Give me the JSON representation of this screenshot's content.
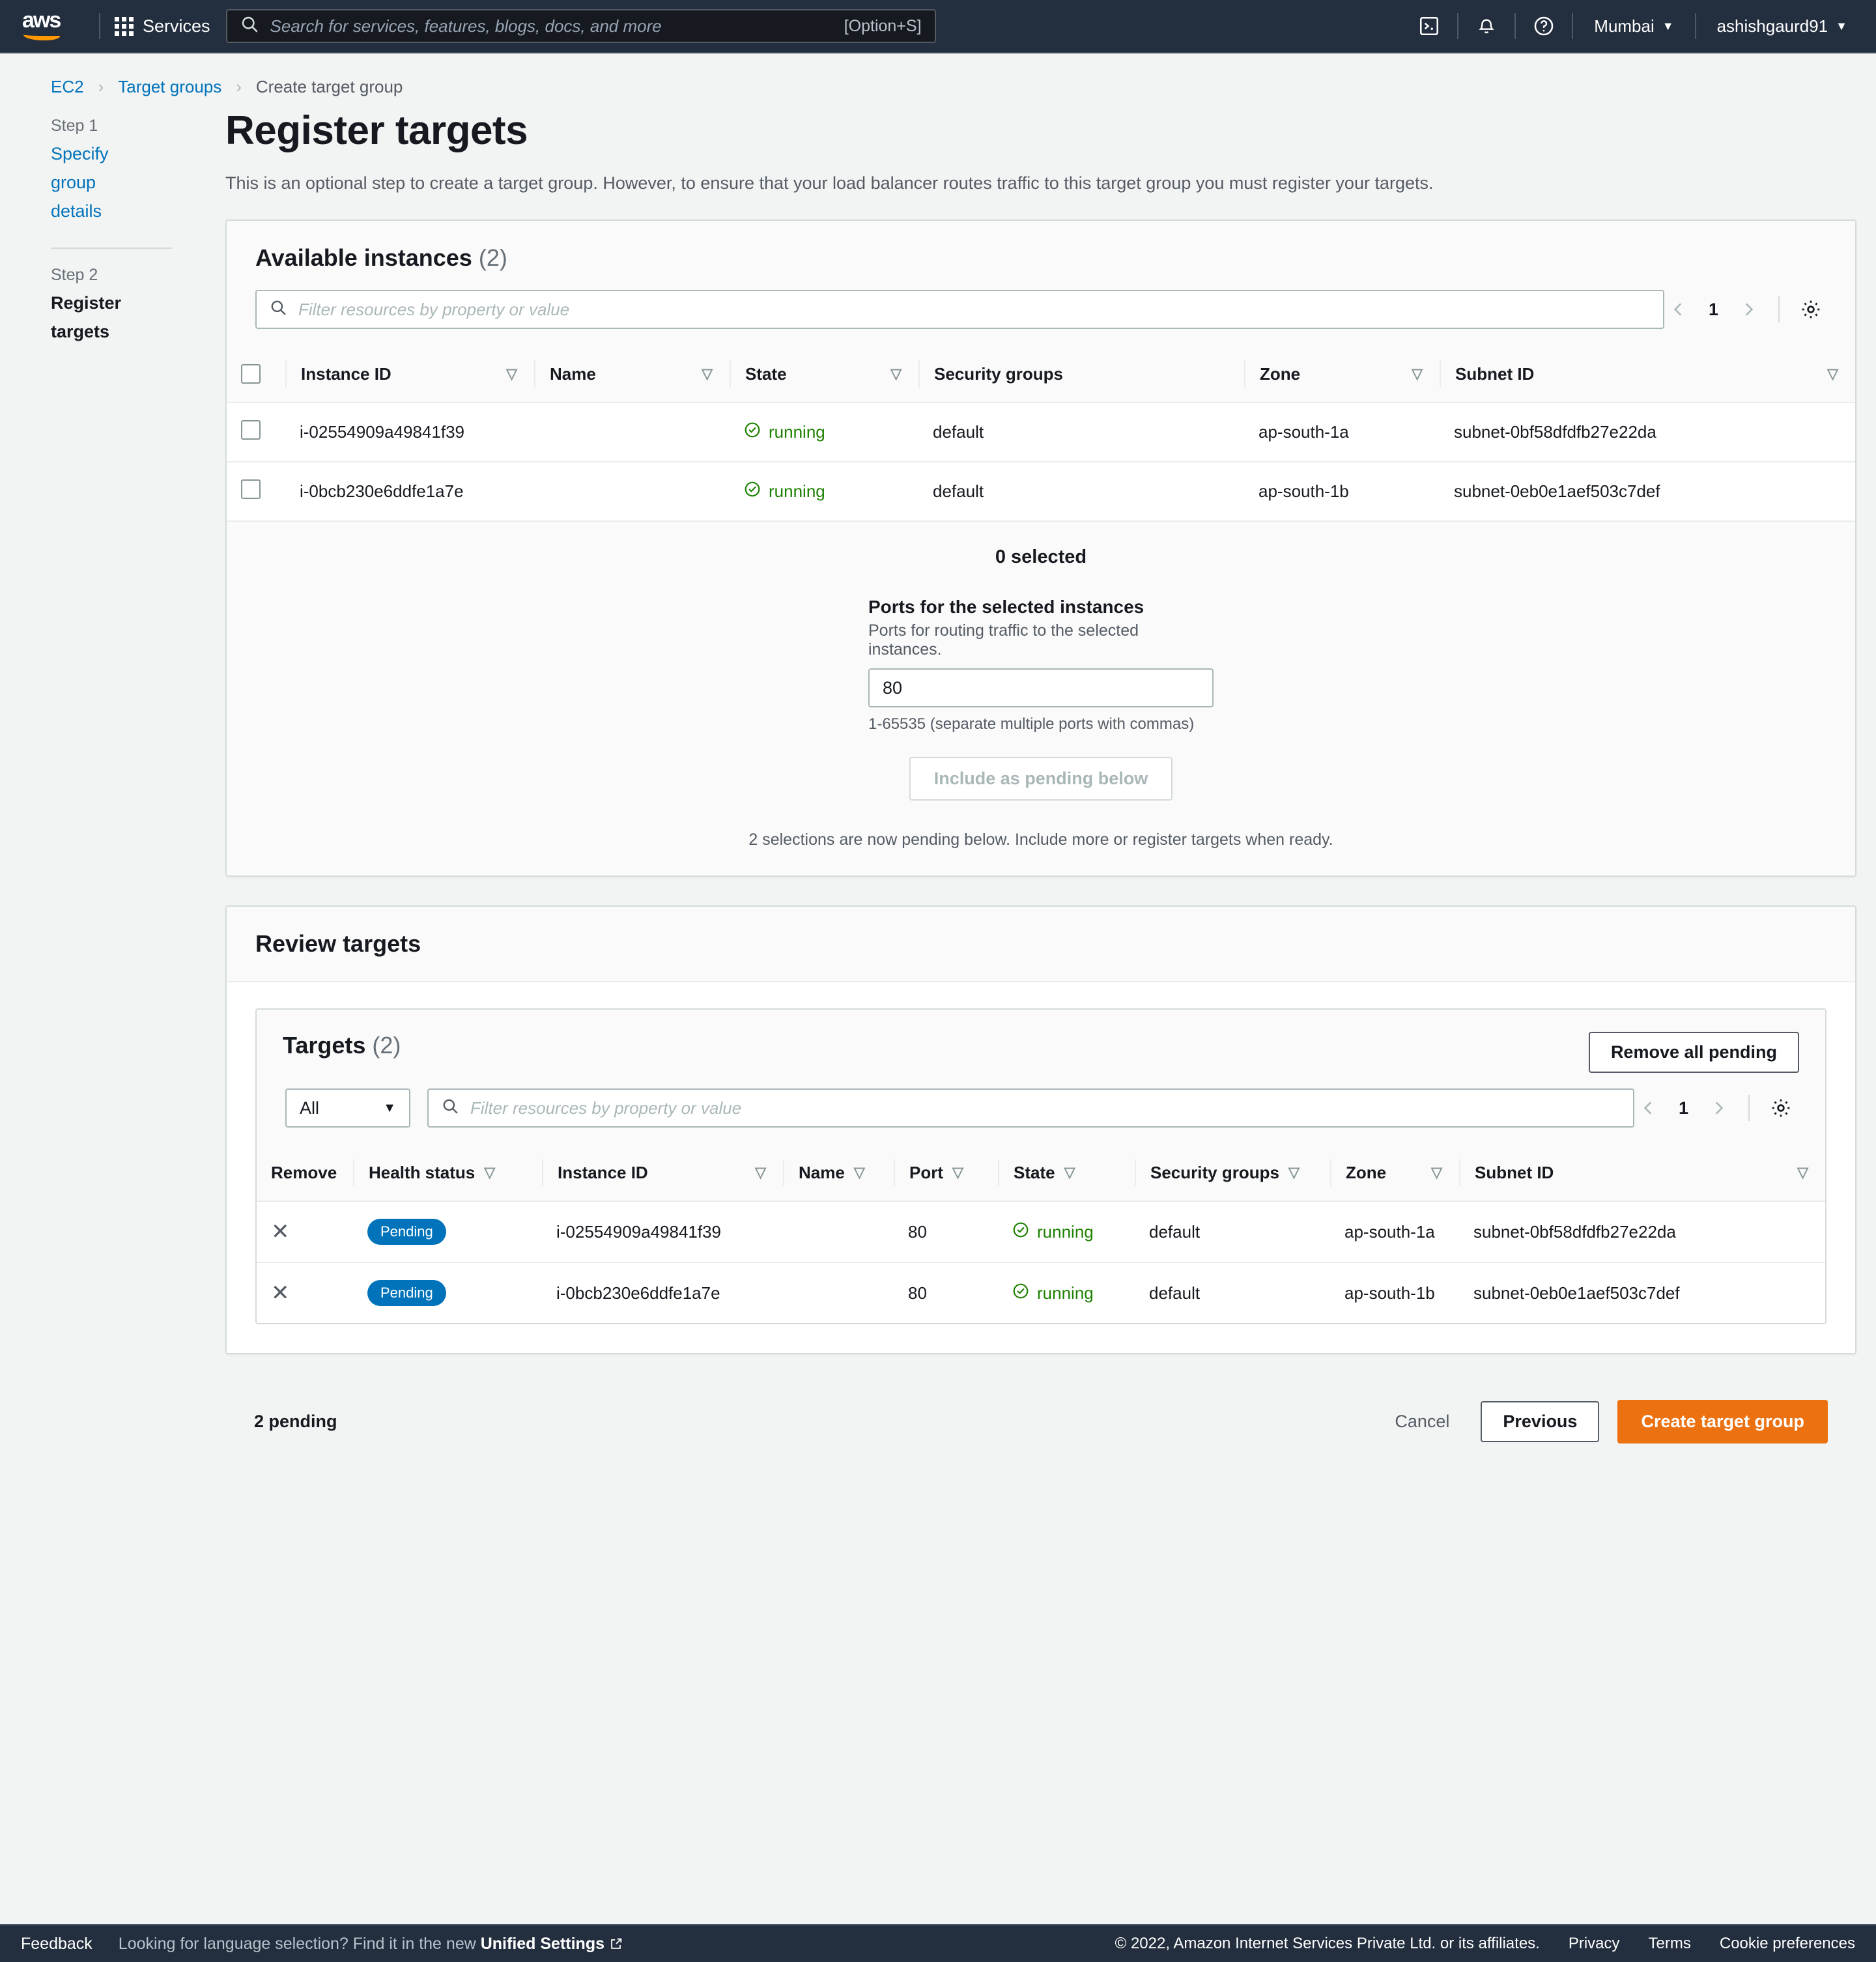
{
  "topnav": {
    "logo_text": "aws",
    "services_label": "Services",
    "search_placeholder": "Search for services, features, blogs, docs, and more",
    "search_value": "",
    "keyboard_hint": "[Option+S]",
    "cloudshell_icon": "cloudshell-icon",
    "bell_icon": "notifications-bell-icon",
    "help_icon": "help-question-icon",
    "region": "Mumbai",
    "account": "ashishgaurd91"
  },
  "breadcrumb": {
    "items": [
      {
        "label": "EC2",
        "link": true
      },
      {
        "label": "Target groups",
        "link": true
      },
      {
        "label": "Create target group",
        "link": false
      }
    ],
    "separator": "›"
  },
  "steps": [
    {
      "num": "Step 1",
      "label_line1": "Specify",
      "label_line2": "group",
      "label_line3": "details",
      "active": false
    },
    {
      "num": "Step 2",
      "label_line1": "Register",
      "label_line2": "targets",
      "label_line3": "",
      "active": true
    }
  ],
  "page": {
    "title": "Register targets",
    "description": "This is an optional step to create a target group. However, to ensure that your load balancer routes traffic to this target group you must register your targets."
  },
  "available_instances": {
    "title": "Available instances",
    "count": "(2)",
    "filter_placeholder": "Filter resources by property or value",
    "filter_value": "",
    "page_number": "1",
    "prev_icon": "chevron-left-icon",
    "next_icon": "chevron-right-icon",
    "settings_icon": "gear-icon",
    "columns": [
      "Instance ID",
      "Name",
      "State",
      "Security groups",
      "Zone",
      "Subnet ID"
    ],
    "sortable": [
      true,
      true,
      true,
      false,
      true,
      true
    ],
    "rows": [
      {
        "instance_id": "i-02554909a49841f39",
        "name": "",
        "state": "running",
        "security_groups": "default",
        "zone": "ap-south-1a",
        "subnet_id": "subnet-0bf58dfdfb27e22da"
      },
      {
        "instance_id": "i-0bcb230e6ddfe1a7e",
        "name": "",
        "state": "running",
        "security_groups": "default",
        "zone": "ap-south-1b",
        "subnet_id": "subnet-0eb0e1aef503c7def"
      }
    ],
    "selection": {
      "selected_text": "0 selected",
      "ports_label": "Ports for the selected instances",
      "ports_description": "Ports for routing traffic to the selected instances.",
      "ports_value": "80",
      "ports_hint": "1-65535 (separate multiple ports with commas)",
      "include_button": "Include as pending below",
      "include_button_disabled": true,
      "pending_note": "2 selections are now pending below. Include more or register targets when ready."
    }
  },
  "review_targets": {
    "title": "Review targets",
    "targets_title": "Targets",
    "targets_count": "(2)",
    "remove_all_button": "Remove all pending",
    "select_value": "All",
    "filter_placeholder": "Filter resources by property or value",
    "filter_value": "",
    "page_number": "1",
    "columns": [
      "Remove",
      "Health status",
      "Instance ID",
      "Name",
      "Port",
      "State",
      "Security groups",
      "Zone",
      "Subnet ID"
    ],
    "rows": [
      {
        "remove_icon": "remove-x-icon",
        "health_status": "Pending",
        "instance_id": "i-02554909a49841f39",
        "name": "",
        "port": "80",
        "state": "running",
        "security_groups": "default",
        "zone": "ap-south-1a",
        "subnet_id": "subnet-0bf58dfdfb27e22da"
      },
      {
        "remove_icon": "remove-x-icon",
        "health_status": "Pending",
        "instance_id": "i-0bcb230e6ddfe1a7e",
        "name": "",
        "port": "80",
        "state": "running",
        "security_groups": "default",
        "zone": "ap-south-1b",
        "subnet_id": "subnet-0eb0e1aef503c7def"
      }
    ]
  },
  "action_bar": {
    "pending_count": "2 pending",
    "cancel": "Cancel",
    "previous": "Previous",
    "create": "Create target group"
  },
  "footer": {
    "feedback": "Feedback",
    "language_prefix": "Looking for language selection? Find it in the new ",
    "language_link": "Unified Settings",
    "copyright": "© 2022, Amazon Internet Services Private Ltd. or its affiliates.",
    "privacy": "Privacy",
    "terms": "Terms",
    "cookies": "Cookie preferences"
  },
  "colors": {
    "nav_bg": "#232f3e",
    "accent_orange": "#ec7211",
    "link_blue": "#0073bb",
    "badge_blue": "#0073bb",
    "state_green": "#1d8102",
    "page_bg": "#f2f3f3"
  }
}
